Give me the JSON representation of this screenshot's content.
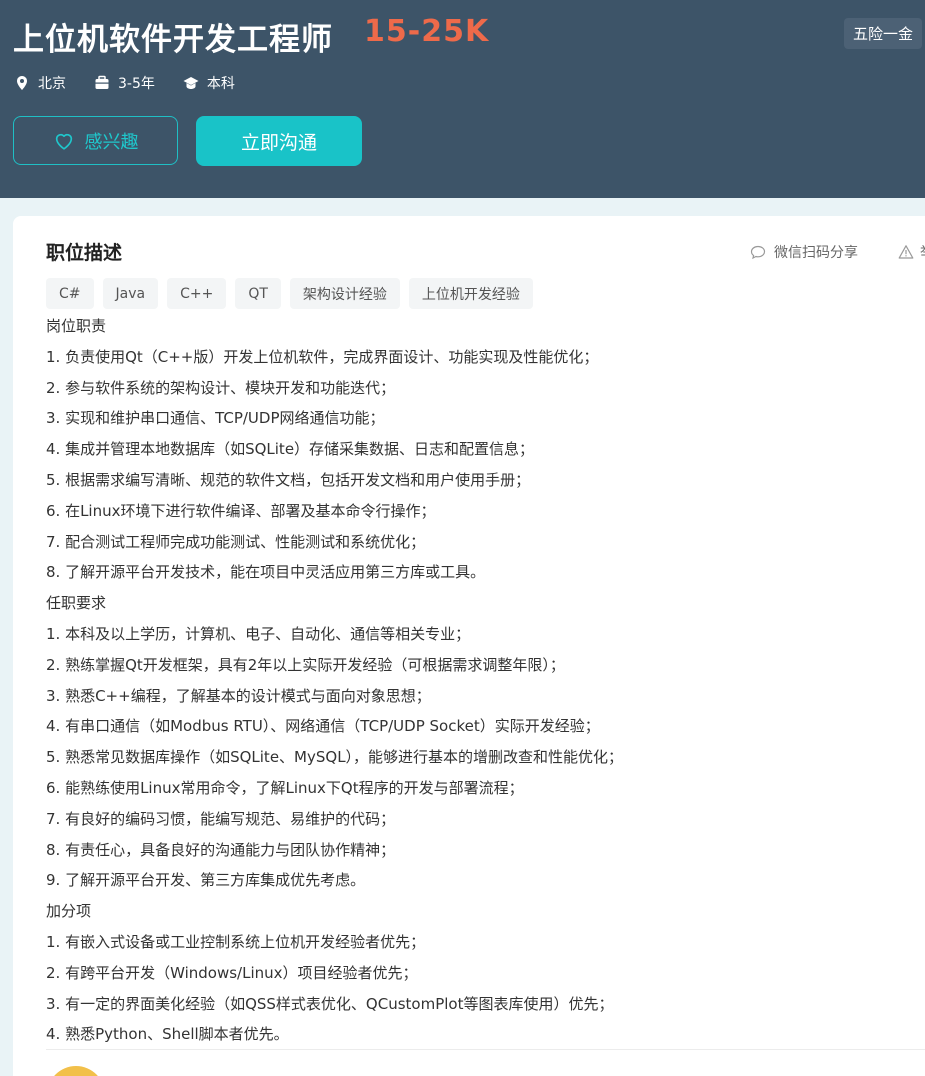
{
  "job": {
    "title": "上位机软件开发工程师",
    "salary": "15-25K",
    "benefit": "五险一金",
    "location": "北京",
    "experience": "3-5年",
    "education": "本科"
  },
  "actions": {
    "interest_label": "感兴趣",
    "chat_label": "立即沟通"
  },
  "description": {
    "title": "职位描述",
    "share_label": "微信扫码分享",
    "report_label": "举报",
    "tags": [
      "C#",
      "Java",
      "C++",
      "QT",
      "架构设计经验",
      "上位机开发经验"
    ],
    "lines": [
      "岗位职责",
      "1. 负责使用Qt（C++版）开发上位机软件，完成界面设计、功能实现及性能优化；",
      "2. 参与软件系统的架构设计、模块开发和功能迭代；",
      "3. 实现和维护串口通信、TCP/UDP网络通信功能；",
      "4. 集成并管理本地数据库（如SQLite）存储采集数据、日志和配置信息；",
      "5. 根据需求编写清晰、规范的软件文档，包括开发文档和用户使用手册；",
      "6. 在Linux环境下进行软件编译、部署及基本命令行操作；",
      "7. 配合测试工程师完成功能测试、性能测试和系统优化；",
      "8. 了解开源平台开发技术，能在项目中灵活应用第三方库或工具。",
      "任职要求",
      "1. 本科及以上学历，计算机、电子、自动化、通信等相关专业；",
      "2. 熟练掌握Qt开发框架，具有2年以上实际开发经验（可根据需求调整年限）；",
      "3. 熟悉C++编程，了解基本的设计模式与面向对象思想；",
      "4. 有串口通信（如Modbus RTU）、网络通信（TCP/UDP Socket）实际开发经验；",
      "5. 熟悉常见数据库操作（如SQLite、MySQL），能够进行基本的增删改查和性能优化；",
      "6. 能熟练使用Linux常用命令，了解Linux下Qt程序的开发与部署流程；",
      "7. 有良好的编码习惯，能编写规范、易维护的代码；",
      "8. 有责任心，具备良好的沟通能力与团队协作精神；",
      "9. 了解开源平台开发、第三方库集成优先考虑。",
      "加分项",
      "1. 有嵌入式设备或工业控制系统上位机开发经验者优先；",
      "2. 有跨平台开发（Windows/Linux）项目经验者优先；",
      "3. 有一定的界面美化经验（如QSS样式表优化、QCustomPlot等图表库使用）优先；",
      "4. 熟悉Python、Shell脚本者优先。"
    ]
  },
  "colors": {
    "header_bg": "#3d5468",
    "salary": "#ee6a4a",
    "accent": "#19c3c8"
  }
}
